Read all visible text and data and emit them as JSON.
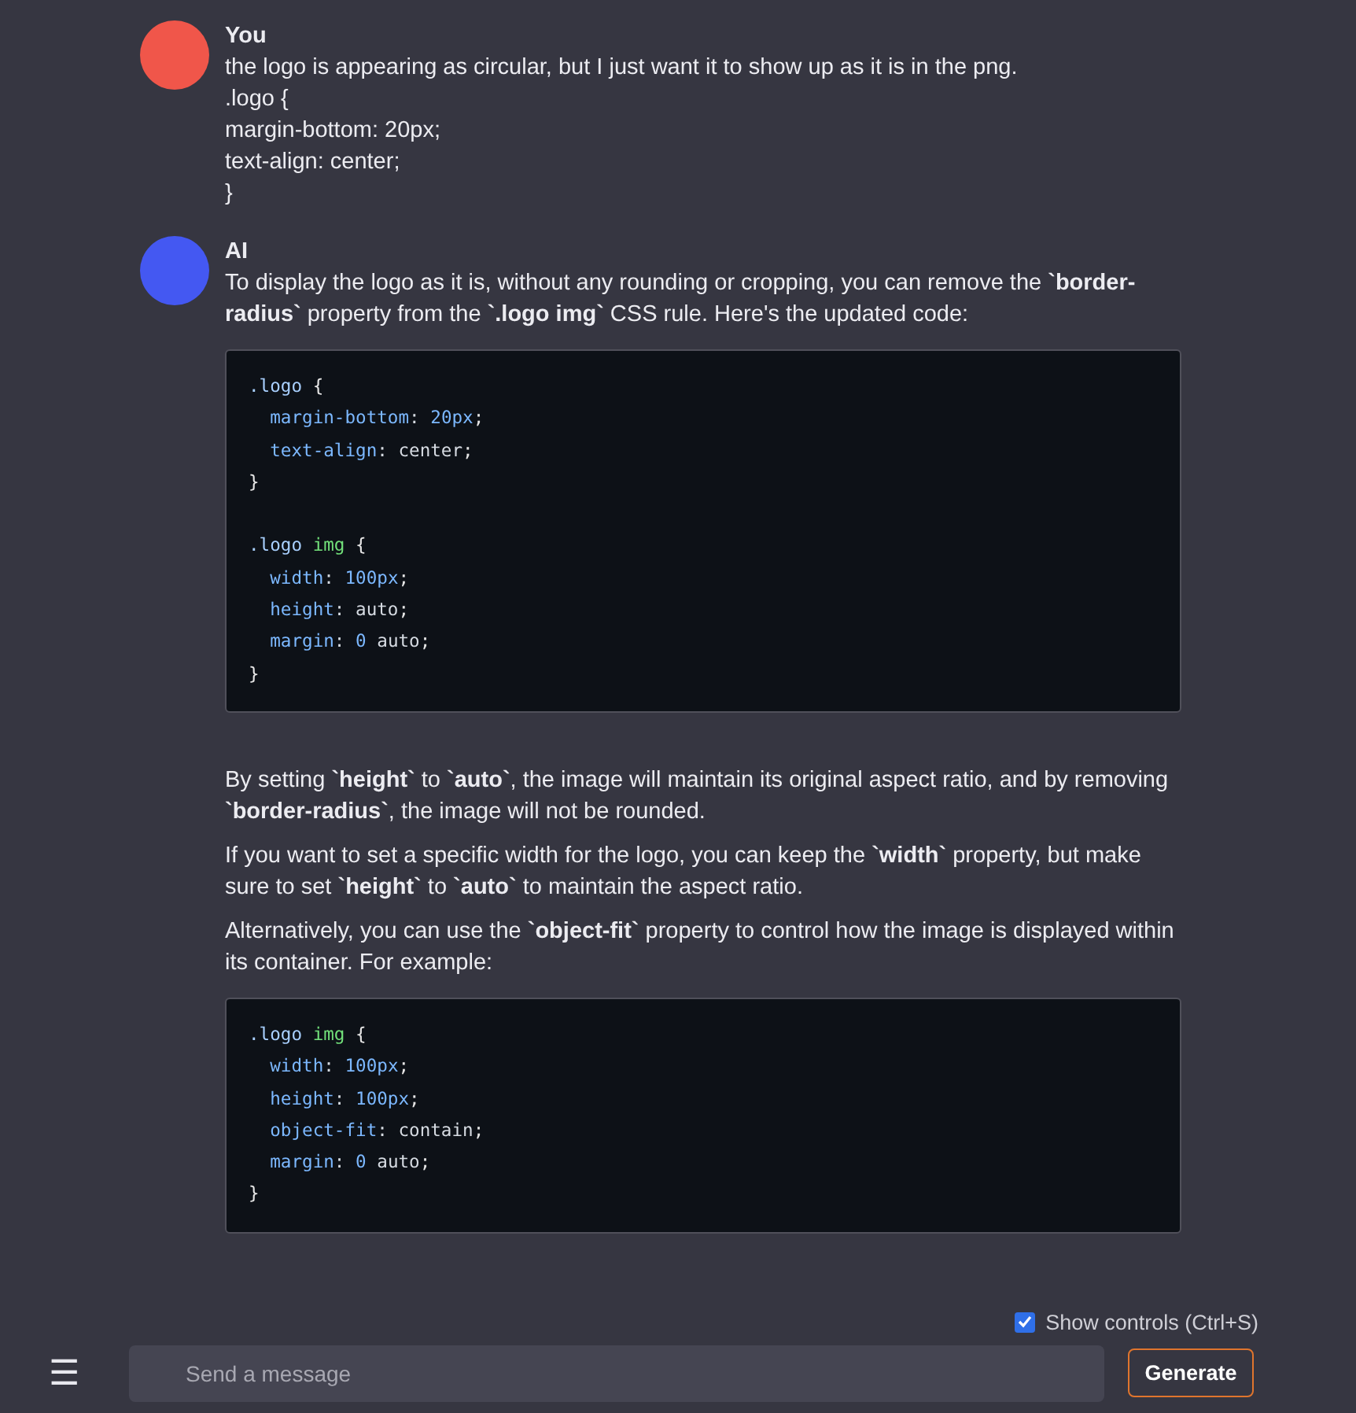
{
  "messages": [
    {
      "author": "You",
      "color": "#f0564a",
      "content": [
        {
          "kind": "text",
          "text": "the logo is appearing as circular, but I just want it to show up as it is in the png."
        },
        {
          "kind": "line",
          "text": ".logo {"
        },
        {
          "kind": "line",
          "text": "margin-bottom: 20px;"
        },
        {
          "kind": "line",
          "text": "text-align: center;"
        },
        {
          "kind": "line",
          "text": "}"
        }
      ]
    },
    {
      "author": "AI",
      "color": "#4458f2",
      "content": [
        {
          "kind": "text",
          "text": "To display the logo as it is, without any rounding or cropping, you can remove the **`border-radius`** property from the **`.logo img`** CSS rule. Here's the updated code:"
        },
        {
          "kind": "code",
          "rules": [
            [
              ".logo {",
              "  margin-bottom: 20px;",
              "  text-align: center;",
              "}"
            ],
            [
              ".logo img {",
              "  width: 100px;",
              "  height: auto;",
              "  margin: 0 auto;",
              "}"
            ]
          ]
        },
        {
          "kind": "text",
          "text": "By setting **`height`** to **`auto`**, the image will maintain its original aspect ratio, and by removing **`border-radius`**, the image will not be rounded."
        },
        {
          "kind": "text",
          "text": "If you want to set a specific width for the logo, you can keep the **`width`** property, but make sure to set **`height`** to **`auto`** to maintain the aspect ratio."
        },
        {
          "kind": "text",
          "text": "Alternatively, you can use the **`object-fit`** property to control how the image is displayed within its container. For example:"
        },
        {
          "kind": "code",
          "rules": [
            [
              ".logo img {",
              "  width: 100px;",
              "  height: 100px;",
              "  object-fit: contain;",
              "  margin: 0 auto;",
              "}"
            ]
          ]
        }
      ]
    }
  ],
  "show_controls": {
    "label": "Show controls (Ctrl+S)",
    "checked": true
  },
  "composer": {
    "menu": "☰",
    "placeholder": "Send a message",
    "button": "Generate"
  }
}
